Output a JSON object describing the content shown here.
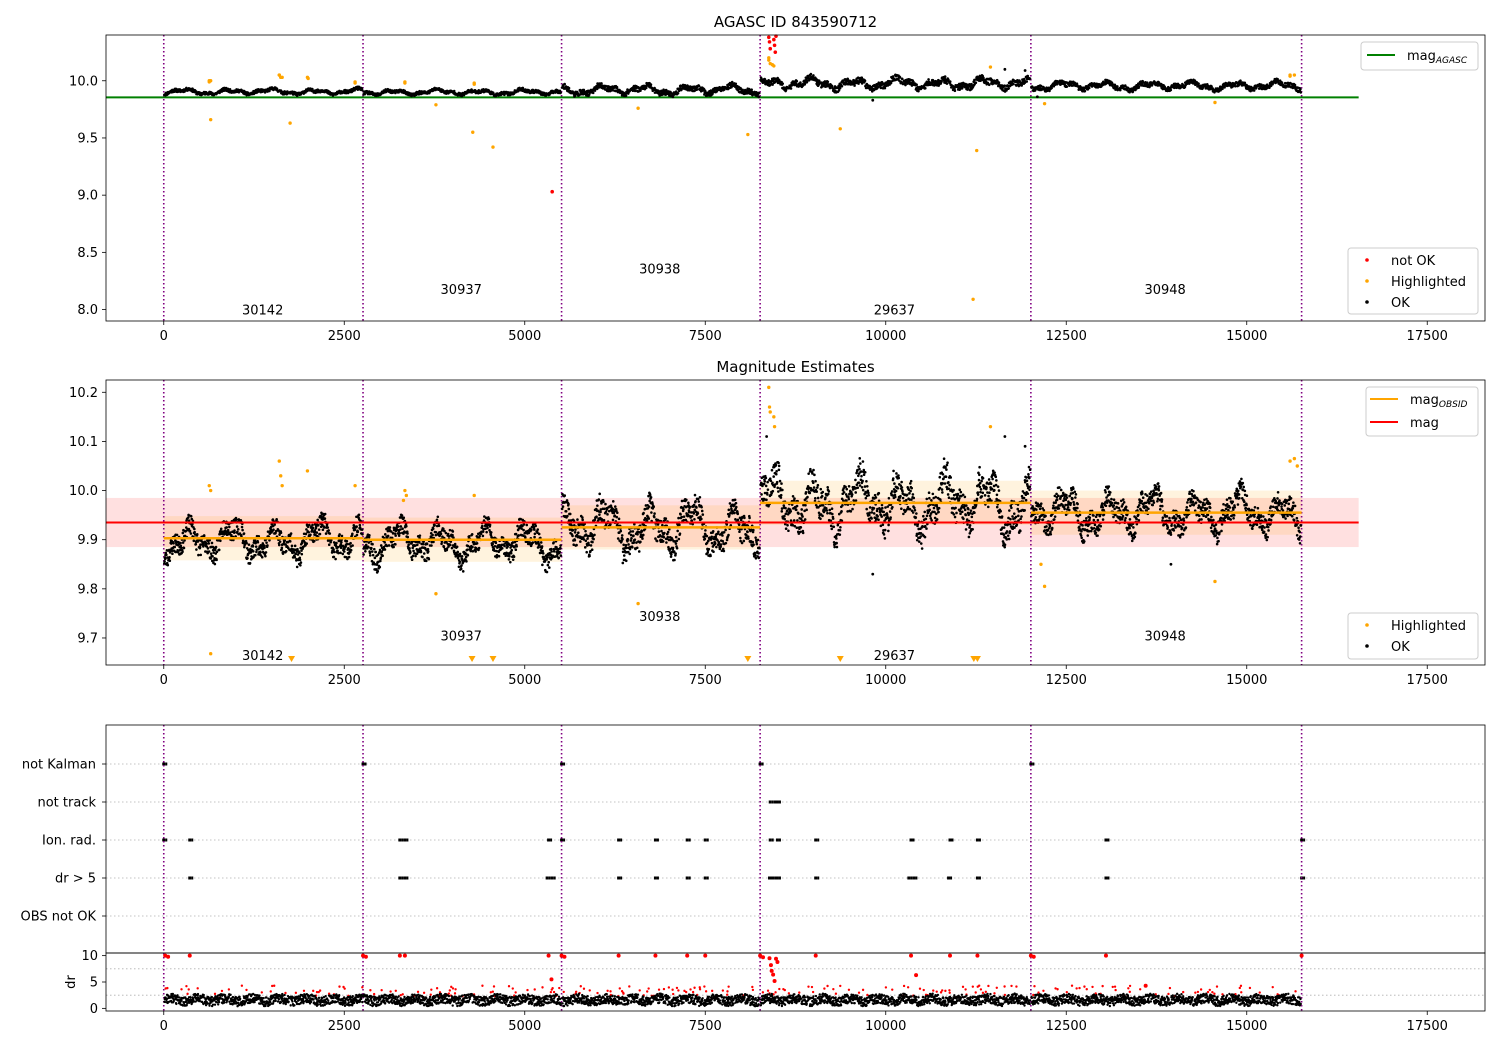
{
  "chart_data": [
    {
      "type": "scatter",
      "title": "AGASC ID 843590712",
      "xlabel": "",
      "ylabel": "",
      "xlim": [
        -800,
        18300
      ],
      "ylim": [
        7.9,
        10.4
      ],
      "x_ticks": [
        0,
        2500,
        5000,
        7500,
        10000,
        12500,
        15000,
        17500
      ],
      "x_tick_labels": [
        "0",
        "2500",
        "5000",
        "7500",
        "10000",
        "12500",
        "15000",
        "17500"
      ],
      "y_ticks": [
        8.0,
        8.5,
        9.0,
        9.5,
        10.0
      ],
      "y_tick_labels": [
        "8.0",
        "8.5",
        "9.0",
        "9.5",
        "10.0"
      ],
      "legend_top": [
        {
          "label": "mag",
          "sub": "AGASC",
          "color": "#008000",
          "kind": "line"
        }
      ],
      "legend_bottom": [
        {
          "label": "not OK",
          "color": "#ff0000",
          "kind": "marker"
        },
        {
          "label": "Highlighted",
          "color": "#ffa500",
          "kind": "marker"
        },
        {
          "label": "OK",
          "color": "#000000",
          "kind": "marker"
        }
      ],
      "obsid_boundaries": [
        0,
        2760,
        5510,
        8260,
        12010,
        15760
      ],
      "obsid_labels": [
        {
          "text": "30142",
          "x": 1370,
          "y": 8.0
        },
        {
          "text": "30937",
          "x": 4120,
          "y": 8.18
        },
        {
          "text": "30938",
          "x": 6870,
          "y": 8.36
        },
        {
          "text": "29637",
          "x": 10120,
          "y": 8.0
        },
        {
          "text": "30948",
          "x": 13870,
          "y": 8.18
        }
      ],
      "mag_agasc": 9.855,
      "mag_agasc_xrange": [
        -800,
        16550
      ],
      "series": [
        {
          "name": "OK",
          "color": "#000000",
          "segments": [
            {
              "x0": 0,
              "x1": 2760,
              "base": 9.905,
              "amp": 0.03
            },
            {
              "x0": 2760,
              "x1": 5510,
              "base": 9.9,
              "amp": 0.03
            },
            {
              "x0": 5510,
              "x1": 8260,
              "base": 9.92,
              "amp": 0.05
            },
            {
              "x0": 8260,
              "x1": 12010,
              "base": 9.975,
              "amp": 0.06
            },
            {
              "x0": 12010,
              "x1": 15760,
              "base": 9.955,
              "amp": 0.045
            }
          ],
          "points": [
            [
              9820,
              9.83
            ],
            [
              12100,
              9.86
            ],
            [
              11650,
              10.1
            ],
            [
              11930,
              10.09
            ]
          ]
        },
        {
          "name": "Highlighted",
          "color": "#ffa500",
          "points": [
            [
              650,
              9.66
            ],
            [
              1750,
              9.63
            ],
            [
              4280,
              9.55
            ],
            [
              4560,
              9.42
            ],
            [
              6570,
              9.76
            ],
            [
              8090,
              9.53
            ],
            [
              9370,
              9.58
            ],
            [
              11210,
              8.09
            ],
            [
              11260,
              9.39
            ],
            [
              12200,
              9.8
            ],
            [
              14560,
              9.81
            ],
            [
              3770,
              9.79
            ],
            [
              630,
              10.0
            ],
            [
              1600,
              10.05
            ],
            [
              1620,
              10.03
            ],
            [
              1990,
              10.03
            ],
            [
              2650,
              9.99
            ],
            [
              3340,
              9.99
            ],
            [
              4300,
              9.98
            ],
            [
              8380,
              10.2
            ],
            [
              8400,
              10.15
            ],
            [
              8450,
              10.13
            ],
            [
              11450,
              10.12
            ],
            [
              15600,
              10.05
            ],
            [
              15660,
              10.05
            ]
          ]
        },
        {
          "name": "not OK",
          "color": "#ff0000",
          "points": [
            [
              5380,
              9.03
            ],
            [
              8380,
              10.38
            ],
            [
              8390,
              10.34
            ],
            [
              8400,
              10.28
            ],
            [
              8450,
              10.36
            ],
            [
              8460,
              10.31
            ],
            [
              8470,
              10.25
            ],
            [
              8480,
              10.39
            ]
          ]
        }
      ]
    },
    {
      "type": "scatter",
      "title": "Magnitude Estimates",
      "xlabel": "",
      "ylabel": "",
      "xlim": [
        -800,
        18300
      ],
      "ylim": [
        9.645,
        10.225
      ],
      "x_ticks": [
        0,
        2500,
        5000,
        7500,
        10000,
        12500,
        15000,
        17500
      ],
      "x_tick_labels": [
        "0",
        "2500",
        "5000",
        "7500",
        "10000",
        "12500",
        "15000",
        "17500"
      ],
      "y_ticks": [
        9.7,
        9.8,
        9.9,
        10.0,
        10.1,
        10.2
      ],
      "y_tick_labels": [
        "9.7",
        "9.8",
        "9.9",
        "10.0",
        "10.1",
        "10.2"
      ],
      "legend_top": [
        {
          "label": "mag",
          "sub": "OBSID",
          "color": "#ffa500",
          "kind": "line"
        },
        {
          "label": "mag",
          "sub": "",
          "color": "#ff0000",
          "kind": "line"
        }
      ],
      "legend_bottom": [
        {
          "label": "Highlighted",
          "color": "#ffa500",
          "kind": "marker"
        },
        {
          "label": "OK",
          "color": "#000000",
          "kind": "marker"
        }
      ],
      "obsid_boundaries": [
        0,
        2760,
        5510,
        8260,
        12010,
        15760
      ],
      "obsid_labels": [
        {
          "text": "30142",
          "x": 1370,
          "y": 9.665
        },
        {
          "text": "30937",
          "x": 4120,
          "y": 9.705
        },
        {
          "text": "30938",
          "x": 6870,
          "y": 9.745
        },
        {
          "text": "29637",
          "x": 10120,
          "y": 9.665
        },
        {
          "text": "30948",
          "x": 13870,
          "y": 9.705
        }
      ],
      "mag_mean": 9.935,
      "mag_band": [
        9.885,
        9.985
      ],
      "mag_band_xrange": [
        -800,
        16550
      ],
      "obsid_mags": [
        {
          "x0": 0,
          "x1": 2760,
          "mag": 9.903
        },
        {
          "x0": 2760,
          "x1": 5510,
          "mag": 9.9
        },
        {
          "x0": 5510,
          "x1": 8260,
          "mag": 9.925
        },
        {
          "x0": 8260,
          "x1": 12010,
          "mag": 9.975
        },
        {
          "x0": 12010,
          "x1": 15760,
          "mag": 9.955
        }
      ],
      "series": [
        {
          "name": "OK",
          "color": "#000000",
          "segments": [
            {
              "x0": 0,
              "x1": 2760,
              "base": 9.9,
              "amp": 0.045
            },
            {
              "x0": 2760,
              "x1": 5510,
              "base": 9.895,
              "amp": 0.045
            },
            {
              "x0": 5510,
              "x1": 8260,
              "base": 9.925,
              "amp": 0.06
            },
            {
              "x0": 8260,
              "x1": 12010,
              "base": 9.975,
              "amp": 0.07
            },
            {
              "x0": 12010,
              "x1": 15760,
              "base": 9.955,
              "amp": 0.05
            }
          ],
          "points": [
            [
              9820,
              9.83
            ],
            [
              13950,
              9.85
            ],
            [
              8350,
              10.11
            ],
            [
              11650,
              10.11
            ],
            [
              11930,
              10.09
            ]
          ]
        },
        {
          "name": "Highlighted",
          "color": "#ffa500",
          "points": [
            [
              650,
              9.668
            ],
            [
              630,
              10.01
            ],
            [
              650,
              10.0
            ],
            [
              1600,
              10.06
            ],
            [
              1620,
              10.03
            ],
            [
              1640,
              10.01
            ],
            [
              1990,
              10.04
            ],
            [
              2650,
              10.01
            ],
            [
              3340,
              10.0
            ],
            [
              3360,
              9.99
            ],
            [
              3320,
              9.98
            ],
            [
              4300,
              9.99
            ],
            [
              3770,
              9.79
            ],
            [
              6570,
              9.77
            ],
            [
              8380,
              10.21
            ],
            [
              8390,
              10.17
            ],
            [
              8400,
              10.16
            ],
            [
              8450,
              10.15
            ],
            [
              8460,
              10.13
            ],
            [
              11450,
              10.13
            ],
            [
              12150,
              9.85
            ],
            [
              12200,
              9.805
            ],
            [
              14560,
              9.815
            ],
            [
              15600,
              10.06
            ],
            [
              15660,
              10.065
            ],
            [
              15700,
              10.05
            ]
          ]
        }
      ],
      "off_scale_markers": [
        1770,
        4270,
        4560,
        8090,
        9370,
        11220,
        11270
      ]
    },
    {
      "type": "scatter",
      "title": "",
      "xlabel": "",
      "ylabel": "",
      "xlim": [
        -800,
        18300
      ],
      "categories": [
        "not Kalman",
        "not track",
        "Ion. rad.",
        "dr > 5",
        "OBS not OK"
      ],
      "flags": {
        "not Kalman": [
          0,
          2760,
          5510,
          8260,
          12010
        ],
        "not track": [
          8400,
          8470,
          8500
        ],
        "Ion. rad.": [
          0,
          360,
          3270,
          3340,
          5330,
          5510,
          6300,
          6810,
          7250,
          7500,
          8400,
          8500,
          9030,
          10350,
          10890,
          11270,
          13050,
          15760
        ],
        "dr > 5": [
          360,
          3270,
          3340,
          5310,
          5380,
          6300,
          6810,
          7250,
          7500,
          8390,
          8440,
          8500,
          9030,
          10320,
          10390,
          10870,
          11270,
          13050,
          15760
        ],
        "OBS not OK": []
      },
      "obsid_boundaries": [
        0,
        2760,
        5510,
        8260,
        12010,
        15760
      ]
    },
    {
      "type": "scatter",
      "title": "",
      "xlabel": "",
      "ylabel": "dr",
      "xlim": [
        -800,
        18300
      ],
      "ylim": [
        -0.5,
        10.5
      ],
      "x_ticks": [
        0,
        2500,
        5000,
        7500,
        10000,
        12500,
        15000,
        17500
      ],
      "x_tick_labels": [
        "0",
        "2500",
        "5000",
        "7500",
        "10000",
        "12500",
        "15000",
        "17500"
      ],
      "y_ticks": [
        0,
        5,
        10
      ],
      "y_tick_labels": [
        "0",
        "5",
        "10"
      ],
      "obsid_boundaries": [
        0,
        2760,
        5510,
        8260,
        12010,
        15760
      ],
      "series": [
        {
          "name": "OK",
          "color": "#000000",
          "base": 1.6,
          "amp": 0.9
        },
        {
          "name": "not OK",
          "color": "#ff0000",
          "points": [
            [
              20,
              10
            ],
            [
              60,
              9.8
            ],
            [
              360,
              10
            ],
            [
              2760,
              10
            ],
            [
              2800,
              9.8
            ],
            [
              3270,
              10
            ],
            [
              3340,
              10
            ],
            [
              5330,
              10
            ],
            [
              5370,
              5.5
            ],
            [
              5510,
              10
            ],
            [
              5550,
              9.8
            ],
            [
              6300,
              10
            ],
            [
              6810,
              10
            ],
            [
              7250,
              10
            ],
            [
              7500,
              10
            ],
            [
              8260,
              10
            ],
            [
              8300,
              9.7
            ],
            [
              8390,
              9.5
            ],
            [
              8410,
              8.2
            ],
            [
              8420,
              7.1
            ],
            [
              8440,
              6.4
            ],
            [
              8460,
              5.2
            ],
            [
              8480,
              9.4
            ],
            [
              8500,
              8.8
            ],
            [
              9030,
              10
            ],
            [
              10350,
              10
            ],
            [
              10420,
              6.3
            ],
            [
              10890,
              10
            ],
            [
              11270,
              10
            ],
            [
              12010,
              10
            ],
            [
              12050,
              9.8
            ],
            [
              13050,
              10
            ],
            [
              13600,
              4.3
            ],
            [
              15760,
              10
            ]
          ]
        }
      ]
    }
  ]
}
